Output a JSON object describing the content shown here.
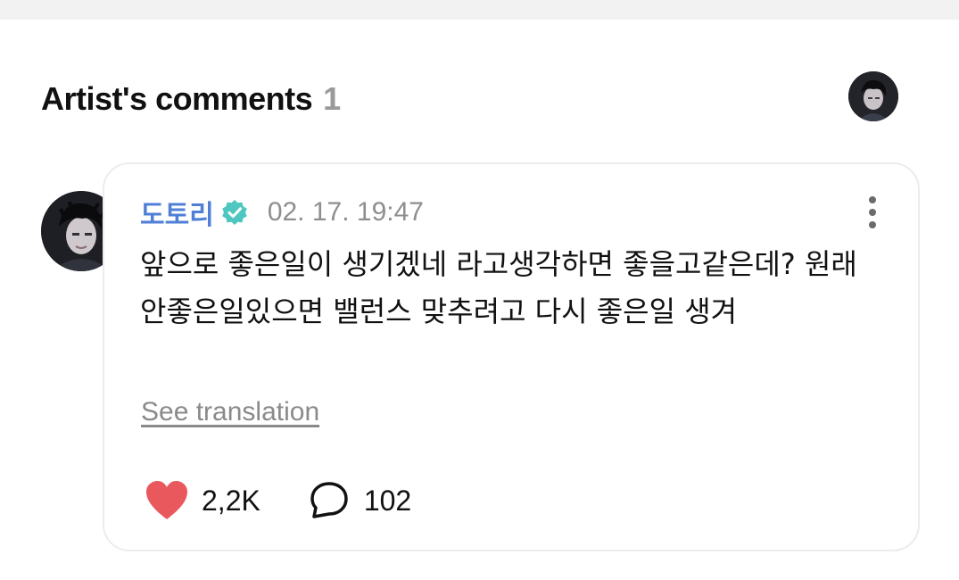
{
  "section": {
    "title": "Artist's comments",
    "count": "1"
  },
  "comment": {
    "author": "도토리",
    "verified": true,
    "timestamp": "02. 17. 19:47",
    "text": "앞으로 좋은일이 생기겠네 라고생각하면 좋을고같은데? 원래 안좋은일있으면 밸런스 맞추려고 다시 좋은일 생겨",
    "see_translation": "See translation",
    "likes": "2,2K",
    "replies": "102"
  },
  "colors": {
    "author_name": "#4f7fd6",
    "verified_badge": "#4fc7c0",
    "heart": "#e8585d",
    "count_muted": "#9a9a9a"
  },
  "icons": {
    "verified": "verified-badge-icon",
    "more": "more-vertical-icon",
    "like": "heart-icon",
    "reply": "speech-bubble-icon"
  }
}
